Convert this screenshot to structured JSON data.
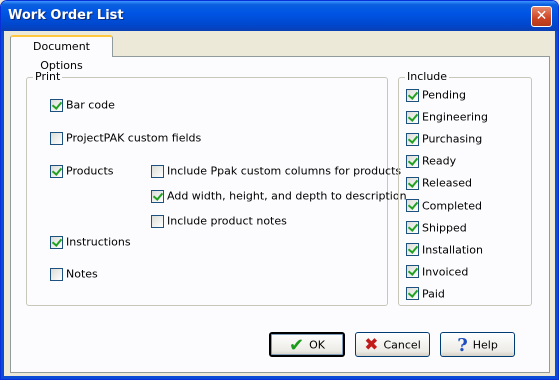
{
  "window": {
    "title": "Work Order List",
    "close_glyph": "✕"
  },
  "tabs": [
    {
      "label": "Document Options",
      "active": true
    }
  ],
  "print_group": {
    "title": "Print",
    "options": {
      "bar_code": {
        "label": "Bar code",
        "checked": true
      },
      "projectpak_custom_fields": {
        "label": "ProjectPAK custom fields",
        "checked": false
      },
      "products": {
        "label": "Products",
        "checked": true
      },
      "include_ppak_columns": {
        "label": "Include Ppak custom columns for products",
        "checked": false
      },
      "add_dimensions": {
        "label": "Add width, height, and depth to description",
        "checked": true
      },
      "include_product_notes": {
        "label": "Include product notes",
        "checked": false
      },
      "instructions": {
        "label": "Instructions",
        "checked": true
      },
      "notes": {
        "label": "Notes",
        "checked": false
      }
    }
  },
  "include_group": {
    "title": "Include",
    "items": [
      {
        "label": "Pending",
        "checked": true
      },
      {
        "label": "Engineering",
        "checked": true
      },
      {
        "label": "Purchasing",
        "checked": true
      },
      {
        "label": "Ready",
        "checked": true
      },
      {
        "label": "Released",
        "checked": true
      },
      {
        "label": "Completed",
        "checked": true
      },
      {
        "label": "Shipped",
        "checked": true
      },
      {
        "label": "Installation",
        "checked": true
      },
      {
        "label": "Invoiced",
        "checked": true
      },
      {
        "label": "Paid",
        "checked": true
      }
    ]
  },
  "buttons": {
    "ok": {
      "label": "OK",
      "icon": "checkmark-icon",
      "glyph": "✔"
    },
    "cancel": {
      "label": "Cancel",
      "icon": "x-icon",
      "glyph": "✖"
    },
    "help": {
      "label": "Help",
      "icon": "question-icon",
      "glyph": "?"
    }
  },
  "colors": {
    "titlebar": "#0055e5",
    "dialog_bg": "#ece9d8",
    "check": "#21a121"
  }
}
